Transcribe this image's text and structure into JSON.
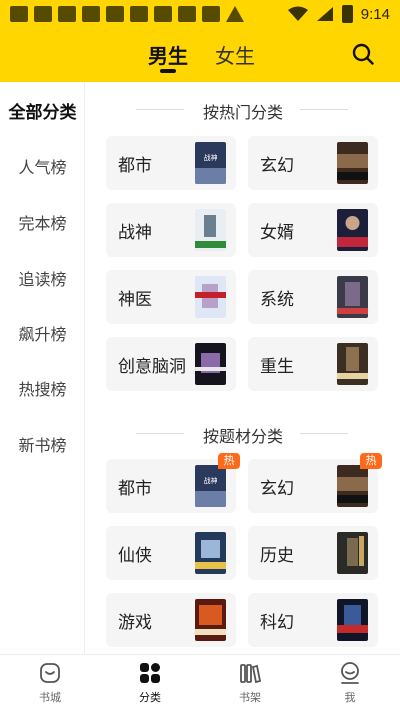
{
  "status_bar": {
    "time": "9:14"
  },
  "header": {
    "tabs": [
      {
        "label": "男生",
        "active": true
      },
      {
        "label": "女生",
        "active": false
      }
    ]
  },
  "sidebar": {
    "items": [
      {
        "label": "全部分类",
        "active": true
      },
      {
        "label": "人气榜"
      },
      {
        "label": "完本榜"
      },
      {
        "label": "追读榜"
      },
      {
        "label": "飙升榜"
      },
      {
        "label": "热搜榜"
      },
      {
        "label": "新书榜"
      }
    ]
  },
  "sections": [
    {
      "title": "按热门分类",
      "cards": [
        {
          "label": "都市",
          "cover": "urban-cover"
        },
        {
          "label": "玄幻",
          "cover": "fantasy-cover"
        },
        {
          "label": "战神",
          "cover": "war-god-cover"
        },
        {
          "label": "女婿",
          "cover": "son-in-law-cover"
        },
        {
          "label": "神医",
          "cover": "divine-doctor-cover"
        },
        {
          "label": "系统",
          "cover": "system-cover"
        },
        {
          "label": "创意脑洞",
          "cover": "creative-cover"
        },
        {
          "label": "重生",
          "cover": "rebirth-cover"
        }
      ]
    },
    {
      "title": "按题材分类",
      "cards": [
        {
          "label": "都市",
          "cover": "urban-cover",
          "badge": "热"
        },
        {
          "label": "玄幻",
          "cover": "fantasy-cover",
          "badge": "热"
        },
        {
          "label": "仙侠",
          "cover": "xianxia-cover"
        },
        {
          "label": "历史",
          "cover": "history-cover"
        },
        {
          "label": "游戏",
          "cover": "game-cover"
        },
        {
          "label": "科幻",
          "cover": "scifi-cover"
        }
      ]
    }
  ],
  "bottom_nav": [
    {
      "label": "书城",
      "icon": "bookstore-icon"
    },
    {
      "label": "分类",
      "icon": "category-icon",
      "active": true
    },
    {
      "label": "书架",
      "icon": "bookshelf-icon"
    },
    {
      "label": "我",
      "icon": "profile-icon"
    }
  ],
  "colors": {
    "accent": "#ffd600",
    "badge": "#ff6a1a",
    "card_bg": "#f5f5f5"
  }
}
